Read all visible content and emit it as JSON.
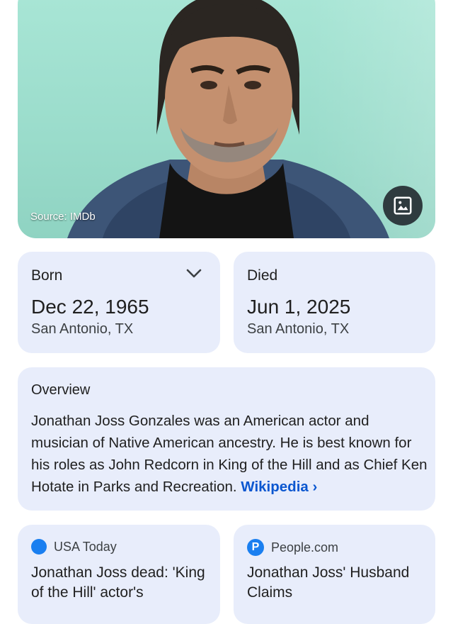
{
  "hero": {
    "source_text": "Source: IMDb",
    "view_images_icon": "image-icon"
  },
  "born": {
    "label": "Born",
    "date": "Dec 22, 1965",
    "place": "San Antonio, TX",
    "expand_icon": "chevron-down-icon"
  },
  "died": {
    "label": "Died",
    "date": "Jun 1, 2025",
    "place": "San Antonio, TX"
  },
  "overview": {
    "title": "Overview",
    "text": "Jonathan Joss Gonzales was an American actor and musician of Native American ancestry. He is best known for his roles as John Redcorn in King of the Hill and as Chief Ken Hotate in Parks and Recreation. ",
    "link_text": "Wikipedia ›"
  },
  "news": [
    {
      "source": "USA Today",
      "title": "Jonathan Joss dead: 'King of the Hill' actor's"
    },
    {
      "source": "People.com",
      "source_logo": "P",
      "title": "Jonathan Joss' Husband Claims"
    }
  ],
  "colors": {
    "card_bg": "#e8edfb",
    "link": "#0b57d0",
    "news_logo": "#1a7ff0"
  }
}
